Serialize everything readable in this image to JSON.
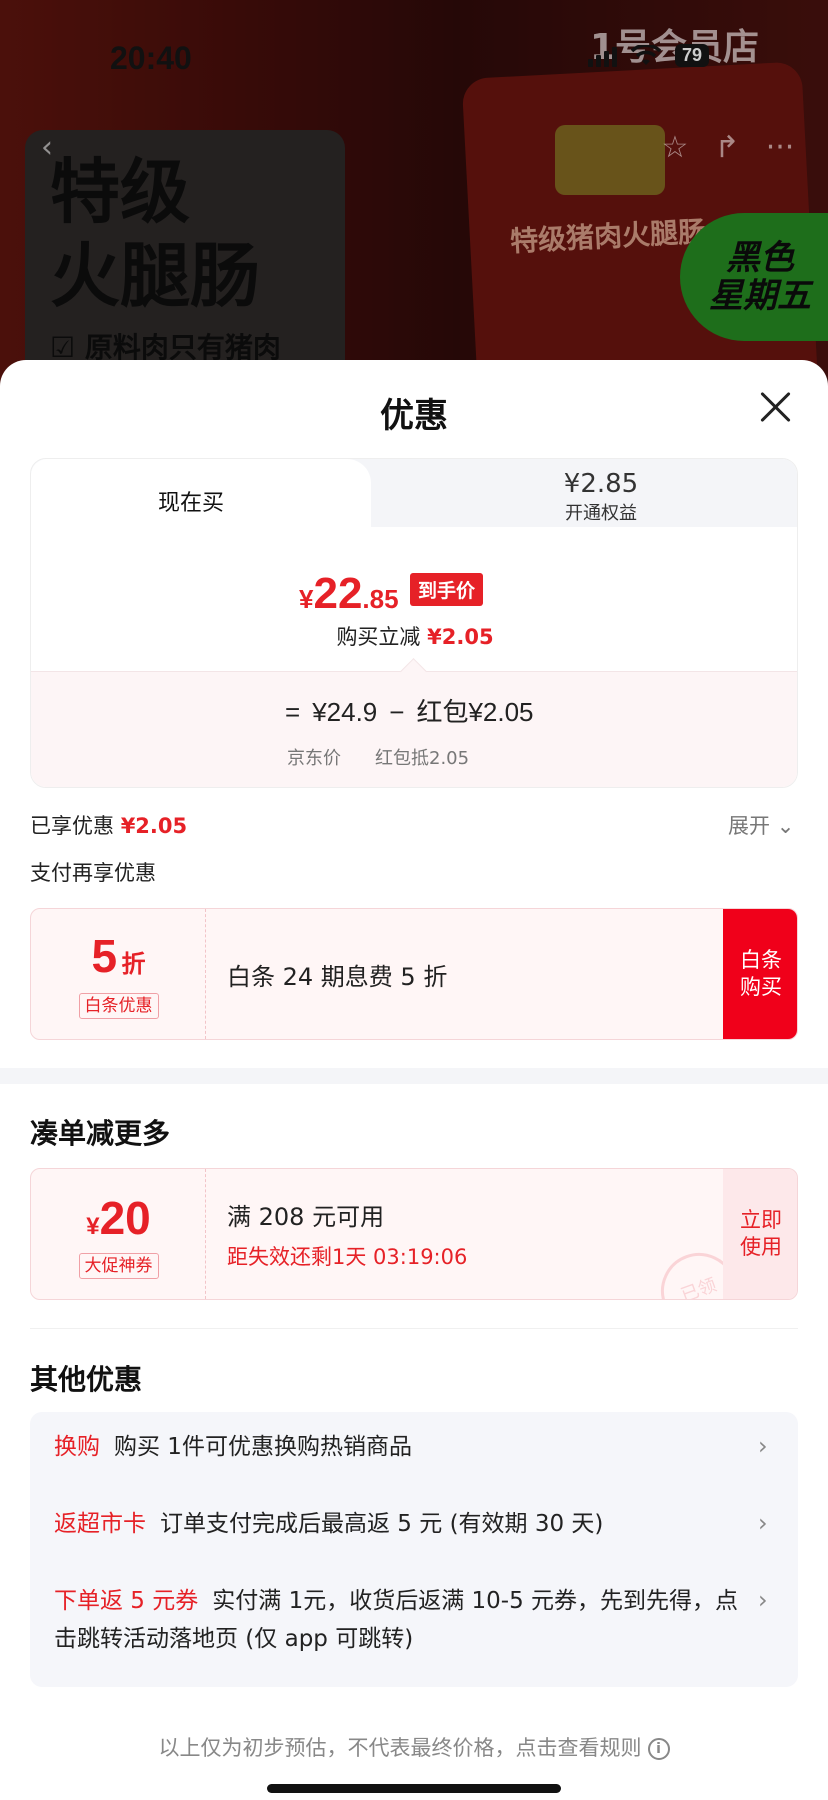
{
  "status": {
    "time": "20:40",
    "battery": "79"
  },
  "background": {
    "brand": "1号会员店",
    "promo_title_line1": "特级",
    "promo_title_line2": "火腿肠",
    "promo_sub": "☑ 原料肉只有猪肉",
    "bag_text": "特级猪肉火腿肠",
    "badge_line1": "黑色",
    "badge_line2": "星期五"
  },
  "sheet": {
    "title": "优惠"
  },
  "tabs": {
    "now_label": "现在买",
    "vip_price": "¥2.85",
    "vip_label": "开通权益"
  },
  "price": {
    "currency": "¥",
    "int": "22",
    "dec": ".85",
    "final_tag": "到手价",
    "reduce_label": "购买立减",
    "reduce_amount": "¥2.05",
    "eq": "=",
    "jd_price": "¥24.9",
    "minus": "−",
    "redpacket": "红包¥2.05",
    "jd_label": "京东价",
    "redpacket_label": "红包抵2.05"
  },
  "summary": {
    "enjoyed_label": "已享优惠",
    "enjoyed_amount": "¥2.05",
    "expand": "展开",
    "pay_more": "支付再享优惠"
  },
  "baitiao": {
    "big_num": "5",
    "big_unit": "折",
    "tag": "白条优惠",
    "desc": "白条 24 期息费 5 折",
    "btn_line1": "白条",
    "btn_line2": "购买"
  },
  "coudan": {
    "title": "凑单减更多",
    "currency": "¥",
    "amount": "20",
    "tag": "大促神券",
    "condition": "满 208 元可用",
    "countdown": "距失效还剩1天 03:19:06",
    "btn_line1": "立即",
    "btn_line2": "使用",
    "stamp": "已领"
  },
  "others": {
    "title": "其他优惠",
    "rows": [
      {
        "tag": "换购",
        "text": "购买 1件可优惠换购热销商品"
      },
      {
        "tag": "返超市卡",
        "text": "订单支付完成后最高返 5 元 (有效期 30 天)"
      },
      {
        "tag": "下单返 5 元券",
        "text": "实付满 1元，收货后返满 10-5 元券，先到先得，点击跳转活动落地页 (仅 app 可跳转)"
      }
    ]
  },
  "footnote": "以上仅为初步预估，不代表最终价格，点击查看规则",
  "colors": {
    "accent_red": "#e62127",
    "button_red": "#f0001a"
  }
}
